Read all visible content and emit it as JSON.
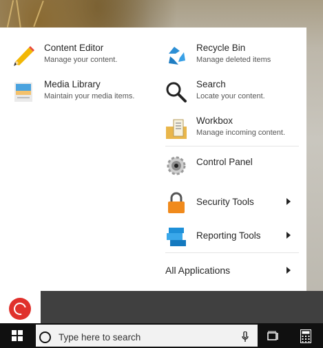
{
  "start_menu": {
    "left_items": [
      {
        "title": "Content Editor",
        "desc": "Manage your content.",
        "icon": "pencil-icon"
      },
      {
        "title": "Media Library",
        "desc": "Maintain your media items.",
        "icon": "media-library-icon"
      }
    ],
    "right_items": [
      {
        "title": "Recycle Bin",
        "desc": "Manage deleted items",
        "icon": "recycle-bin-icon"
      },
      {
        "title": "Search",
        "desc": "Locate your content.",
        "icon": "magnifier-icon"
      },
      {
        "title": "Workbox",
        "desc": "Manage incoming content.",
        "icon": "workbox-icon"
      }
    ],
    "control_panel": {
      "title": "Control Panel",
      "icon": "control-panel-icon"
    },
    "security_tools": {
      "title": "Security Tools",
      "icon": "lock-icon"
    },
    "reporting_tools": {
      "title": "Reporting Tools",
      "icon": "reporting-icon"
    },
    "all_applications": "All Applications"
  },
  "taskbar": {
    "search_placeholder": "Type here to search"
  },
  "colors": {
    "menu_bg": "#ffffff",
    "taskbar_bg": "#101010",
    "logo_red": "#e0312c"
  }
}
